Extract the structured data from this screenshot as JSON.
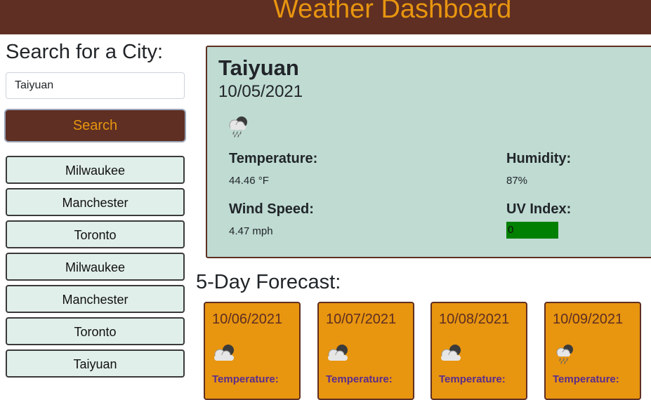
{
  "header": {
    "title": "Weather Dashboard"
  },
  "search": {
    "title": "Search for a City:",
    "input_value": "Taiyuan",
    "button_label": "Search"
  },
  "history": [
    "Milwaukee",
    "Manchester",
    "Toronto",
    "Milwaukee",
    "Manchester",
    "Toronto",
    "Taiyuan"
  ],
  "current": {
    "city": "Taiyuan",
    "date": "10/05/2021",
    "icon": "rain-cloud-icon",
    "temperature_label": "Temperature:",
    "temperature_value": "44.46 °F",
    "humidity_label": "Humidity:",
    "humidity_value": "87%",
    "wind_label": "Wind Speed:",
    "wind_value": "4.47 mph",
    "uv_label": "UV Index:",
    "uv_value": "0",
    "uv_color": "#008000"
  },
  "forecast": {
    "title": "5-Day Forecast:",
    "days": [
      {
        "date": "10/06/2021",
        "icon": "cloudy-icon",
        "temp_label": "Temperature:"
      },
      {
        "date": "10/07/2021",
        "icon": "cloudy-icon",
        "temp_label": "Temperature:"
      },
      {
        "date": "10/08/2021",
        "icon": "cloudy-icon",
        "temp_label": "Temperature:"
      },
      {
        "date": "10/09/2021",
        "icon": "rain-cloud-icon",
        "temp_label": "Temperature:"
      }
    ]
  },
  "colors": {
    "brand_brown": "#5e2f22",
    "accent_orange": "#e8950f",
    "panel_green": "#bfdbd2",
    "history_bg": "#e1efea"
  }
}
